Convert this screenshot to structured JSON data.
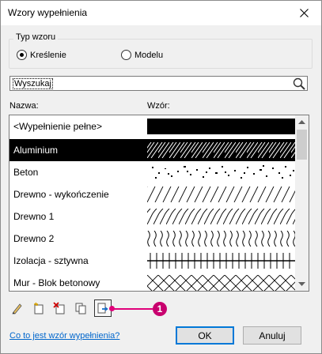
{
  "window": {
    "title": "Wzory wypełnienia"
  },
  "pattern_type": {
    "legend": "Typ wzoru",
    "options": [
      {
        "label": "Kreślenie",
        "selected": true
      },
      {
        "label": "Modelu",
        "selected": false
      }
    ]
  },
  "search": {
    "value": "Wyszukaj"
  },
  "list": {
    "col_name": "Nazwa:",
    "col_pattern": "Wzór:",
    "rows": [
      {
        "name": "<Wypełnienie pełne>",
        "pattern": "solid",
        "selected": false
      },
      {
        "name": "Aluminium",
        "pattern": "diag-double",
        "selected": true
      },
      {
        "name": "Beton",
        "pattern": "speckle",
        "selected": false
      },
      {
        "name": "Drewno - wykończenie",
        "pattern": "diag",
        "selected": false
      },
      {
        "name": "Drewno 1",
        "pattern": "diag-dense",
        "selected": false
      },
      {
        "name": "Drewno 2",
        "pattern": "wavy",
        "selected": false
      },
      {
        "name": "Izolacja - sztywna",
        "pattern": "grid",
        "selected": false
      },
      {
        "name": "Mur - Blok betonowy",
        "pattern": "crosshatch",
        "selected": false
      }
    ]
  },
  "toolbar": {
    "icons": [
      "pencil-icon",
      "new-pattern-icon",
      "delete-pattern-icon",
      "duplicate-pattern-icon",
      "export-pattern-icon"
    ]
  },
  "callout": {
    "number": "1",
    "color": "#c8006e"
  },
  "footer": {
    "help_link": "Co to jest wzór wypełnienia?",
    "ok": "OK",
    "cancel": "Anuluj"
  }
}
